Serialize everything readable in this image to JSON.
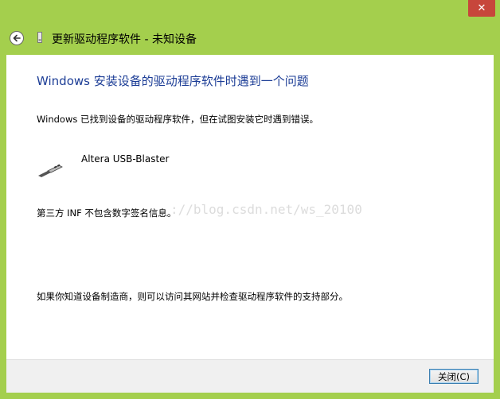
{
  "window": {
    "title": "更新驱动程序软件 - 未知设备",
    "close_glyph": "✕",
    "accent_color": "#a4cf4d",
    "close_color": "#c7463b"
  },
  "content": {
    "heading": "Windows 安装设备的驱动程序软件时遇到一个问题",
    "description": "Windows 已找到设备的驱动程序软件，但在试图安装它时遇到错误。",
    "device_name": "Altera USB-Blaster",
    "inf_message": "第三方 INF 不包含数字签名信息。",
    "help_message": "如果你知道设备制造商，则可以访问其网站并检查驱动程序软件的支持部分。",
    "heading_color": "#1c3d96"
  },
  "watermark": "://blog.csdn.net/ws_20100",
  "footer": {
    "close_label": "关闭(C)"
  },
  "icons": {
    "back": "back-arrow-icon",
    "device_small": "device-icon",
    "usb": "usb-plug-icon"
  }
}
